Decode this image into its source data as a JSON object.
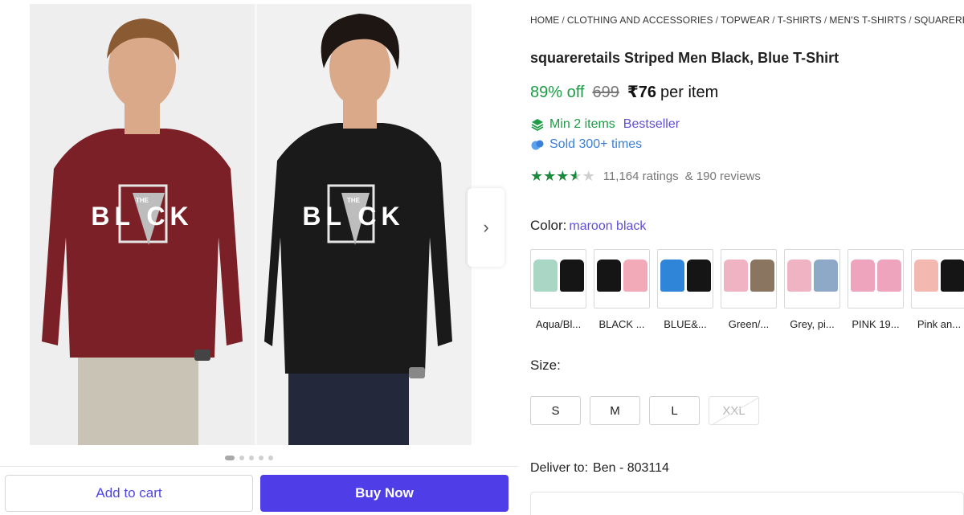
{
  "gallery": {
    "next_icon": "chevron-right-icon",
    "slides_total": 5,
    "active_slide": 1,
    "print_text": "BL CK",
    "print_small": "THE",
    "colors": {
      "maroon": "#7b2027",
      "black": "#1a1a1a",
      "pants_left": "#c9c3b6",
      "pants_right": "#23283a",
      "skin": "#d9a98a",
      "hair_left": "#8a5a33",
      "hair_right": "#1e1613"
    }
  },
  "actions": {
    "add_to_cart": "Add to cart",
    "buy_now": "Buy Now"
  },
  "breadcrumb": [
    "HOME",
    "CLOTHING AND ACCESSORIES",
    "TOPWEAR",
    "T-SHIRTS",
    "MEN'S T-SHIRTS",
    "SQUARERETAILS"
  ],
  "product": {
    "title": "squareretails Striped Men Black, Blue T-Shirt",
    "discount": "89% off",
    "mrp": "699",
    "price": "₹76",
    "price_unit": "per item",
    "min_items": "Min 2 items",
    "bestseller": "Bestseller",
    "sold": "Sold 300+ times",
    "rating_value": 3.5,
    "ratings": "11,164 ratings",
    "reviews": "& 190 reviews"
  },
  "color": {
    "label": "Color:",
    "selected": "maroon black",
    "options": [
      {
        "label": "Aqua/Bl...",
        "c1": "#a9d6c5",
        "c2": "#151515"
      },
      {
        "label": "BLACK ...",
        "c1": "#151515",
        "c2": "#f2a9b8"
      },
      {
        "label": "BLUE&...",
        "c1": "#2f86d8",
        "c2": "#151515"
      },
      {
        "label": "Green/...",
        "c1": "#f0b3c4",
        "c2": "#8a7560"
      },
      {
        "label": "Grey, pi...",
        "c1": "#f0b3c4",
        "c2": "#8ea9c8"
      },
      {
        "label": "PINK 19...",
        "c1": "#efa4be",
        "c2": "#efa4be"
      },
      {
        "label": "Pink an...",
        "c1": "#f3b8b0",
        "c2": "#151515"
      }
    ]
  },
  "size": {
    "label": "Size:",
    "options": [
      "S",
      "M",
      "L",
      "XXL"
    ],
    "unavailable": [
      "XXL"
    ]
  },
  "delivery": {
    "label": "Deliver to:",
    "address": "Ben - 803114"
  }
}
